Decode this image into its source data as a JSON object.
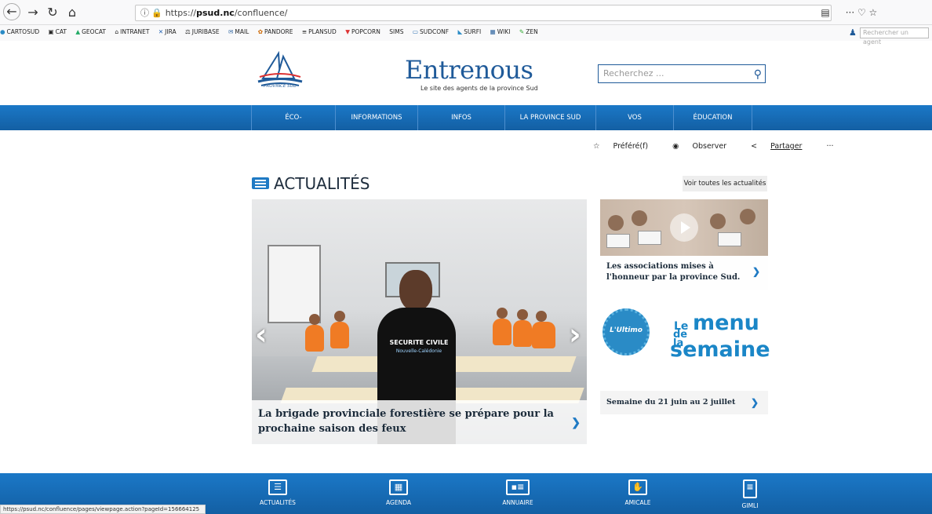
{
  "browser": {
    "url_prefix": "https://",
    "url_host": "psud.nc",
    "url_path": "/confluence/",
    "bookmarks": [
      "CARTOSUD",
      "CAT",
      "GEOCAT",
      "INTRANET",
      "JIRA",
      "JURIBASE",
      "MAIL",
      "PANDORE",
      "PLANSUD",
      "POPCORN",
      "SIMS",
      "SUDCONF",
      "SURFI",
      "WIKI",
      "ZEN"
    ],
    "agent_search_placeholder": "Rechercher un agent",
    "status_url": "https://psud.nc/confluence/pages/viewpage.action?pageId=156664125"
  },
  "header": {
    "logo_text": "PROVINCE SUD",
    "site_title": "Entrenous",
    "site_subtitle": "Le site des agents de la province Sud",
    "search_placeholder": "Recherchez ..."
  },
  "nav": {
    "items": [
      "ÉCO-RESPONSABILITÉ",
      "INFORMATIONS RH",
      "INFOS PRATIQUES",
      "LA PROVINCE SUD",
      "VOS DIRECTIONS",
      "ÉDUCATION"
    ]
  },
  "actions": {
    "favorite": "Préféré(f)",
    "watch": "Observer",
    "share": "Partager",
    "more": "···"
  },
  "news": {
    "title": "ACTUALITÉS",
    "all_button": "Voir toutes les actualités",
    "main_caption": "La brigade provinciale forestière se prépare pour la prochaine saison des feux",
    "shirt_text": "SECURITE CIVILE",
    "shirt_sub": "Nouvelle-Calédonie",
    "card1_caption": "Les associations mises à l'honneur par la province Sud.",
    "menu_logo": "L'Ultimo",
    "menu_le": "Le",
    "menu_menu": "menu",
    "menu_dela": "de la",
    "menu_semaine": "semaine",
    "card2_caption": "Semaine du 21 juin au 2 juillet"
  },
  "footer": {
    "items": [
      "ACTUALITÉS",
      "AGENDA",
      "ANNUAIRE",
      "AMICALE",
      "GIMLI"
    ]
  },
  "colors": {
    "brand_blue": "#1b78c7",
    "accent_blue": "#1f7ac4"
  }
}
